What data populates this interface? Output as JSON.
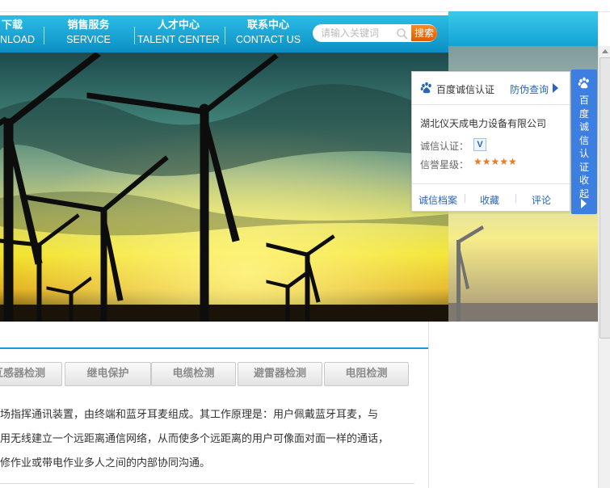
{
  "nav": {
    "items": [
      {
        "cn": "下载",
        "en": "NLOAD"
      },
      {
        "cn": "销售服务",
        "en": "SERVICE"
      },
      {
        "cn": "人才中心",
        "en": "TALENT CENTER"
      },
      {
        "cn": "联系中心",
        "en": "CONTACT US"
      }
    ],
    "search": {
      "placeholder": "请输入关键词",
      "button_label": "搜索"
    }
  },
  "credit_panel": {
    "title": "百度诚信认证",
    "query_link": "防伪查询",
    "company": "湖北仪天成电力设备有限公司",
    "cert_label": "诚信认证：",
    "cert_badge": "V",
    "rating_label": "信誉星级：",
    "stars": "★★★★★",
    "rating_stars": 5,
    "links": [
      "诚信档案",
      "收藏",
      "评论"
    ]
  },
  "side_tab": {
    "label": "百度诚信认证 收起"
  },
  "tabs": [
    "互感器检测",
    "继电保护",
    "电缆检测",
    "避雷器检测",
    "电阻检测"
  ],
  "paragraphs": [
    "场指挥通讯装置，由终端和蓝牙耳麦组成。其工作原理是：用户佩戴蓝牙耳麦，与",
    "用无线建立一个远距离通信网络，从而使多个远距离的用户可像面对面一样的通话，",
    "修作业或带电作业多人之间的内部协同沟通。"
  ],
  "colors": {
    "nav": "#1aa7d9",
    "accent": "#1a9ad6",
    "search_button": "#f07414",
    "credit_blue": "#3d7fe0",
    "stars": "#f2781c"
  }
}
